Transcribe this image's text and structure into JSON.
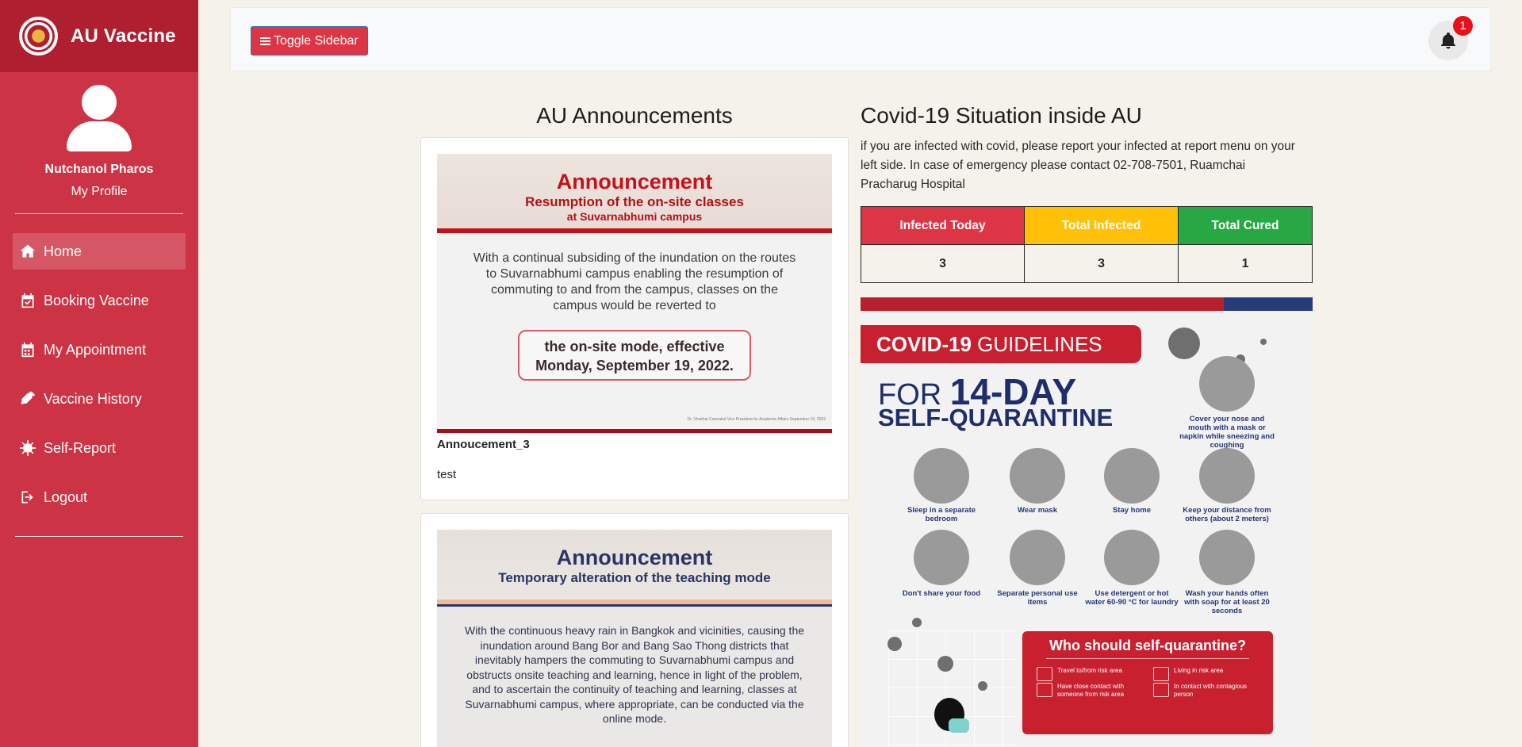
{
  "sidebar": {
    "brand": "AU Vaccine",
    "user_name": "Nutchanol Pharos",
    "profile_link": "My Profile",
    "items": [
      {
        "label": "Home",
        "icon": "home-icon",
        "active": true
      },
      {
        "label": "Booking Vaccine",
        "icon": "calendar-check-icon"
      },
      {
        "label": "My Appointment",
        "icon": "calendar-icon"
      },
      {
        "label": "Vaccine History",
        "icon": "syringe-icon"
      },
      {
        "label": "Self-Report",
        "icon": "virus-icon"
      },
      {
        "label": "Logout",
        "icon": "logout-icon"
      }
    ]
  },
  "topbar": {
    "toggle_label": "Toggle Sidebar",
    "notification_count": "1"
  },
  "announcements": {
    "heading": "AU Announcements",
    "items": [
      {
        "image": {
          "headline": "Announcement",
          "subhead": "Resumption of the on-site classes",
          "subhead2": "at Suvarnabhumi campus",
          "body": "With a continual subsiding of the inundation on the routes to Suvarnabhumi campus enabling the resumption of commuting to and from the campus, classes on the campus would be reverted to",
          "box": "the on-site mode, effective Monday, September 19, 2022.",
          "signature": "Dr. Vinathai Comrakul Vice President for Academic Affairs September 16, 2022"
        },
        "name": "Annoucement_3",
        "text": "test"
      },
      {
        "image": {
          "headline": "Announcement",
          "subhead": "Temporary alteration of the teaching mode",
          "body": "With the continuous heavy rain in Bangkok and vicinities, causing the inundation around Bang Bor and Bang Sao Thong districts that inevitably hampers the commuting to Suvarnabhumi campus and obstructs onsite teaching and learning, hence in light of the problem, and to ascertain the continuity of teaching and learning, classes at Suvarnabhumi campus, where appropriate, can be conducted via the online mode."
        }
      }
    ]
  },
  "covid": {
    "heading": "Covid-19 Situation inside AU",
    "description": "if you are infected with covid, please report your infected at report menu on your left side. In case of emergency please contact 02-708-7501, Ruamchai Pracharug Hospital",
    "stats": {
      "headers": [
        "Infected Today",
        "Total Infected",
        "Total Cured"
      ],
      "values": [
        "3",
        "3",
        "1"
      ],
      "colors": [
        "#dc3545",
        "#ffc107",
        "#28a745"
      ]
    },
    "poster": {
      "pill_bold": "COVID-19",
      "pill_rest": " GUIDELINES",
      "line1_prefix": "FOR ",
      "line1_bold": "14-DAY",
      "line2": "SELF-QUARANTINE",
      "tips": [
        "Cover your nose and mouth with a mask or napkin while sneezing and coughing",
        "Sleep in a separate bedroom",
        "Wear mask",
        "Stay home",
        "Keep your distance from others (about 2 meters)",
        "Don't share your food",
        "Separate personal use items",
        "Use detergent or hot water 60-90 °C for laundry",
        "Wash your hands often with soap for at least 20 seconds"
      ],
      "who_title": "Who should self-quarantine?",
      "who_items": [
        "Travel to/from risk area",
        "Living in risk area",
        "Have close contact with someone from risk area",
        "In contact with contagious person"
      ]
    }
  }
}
